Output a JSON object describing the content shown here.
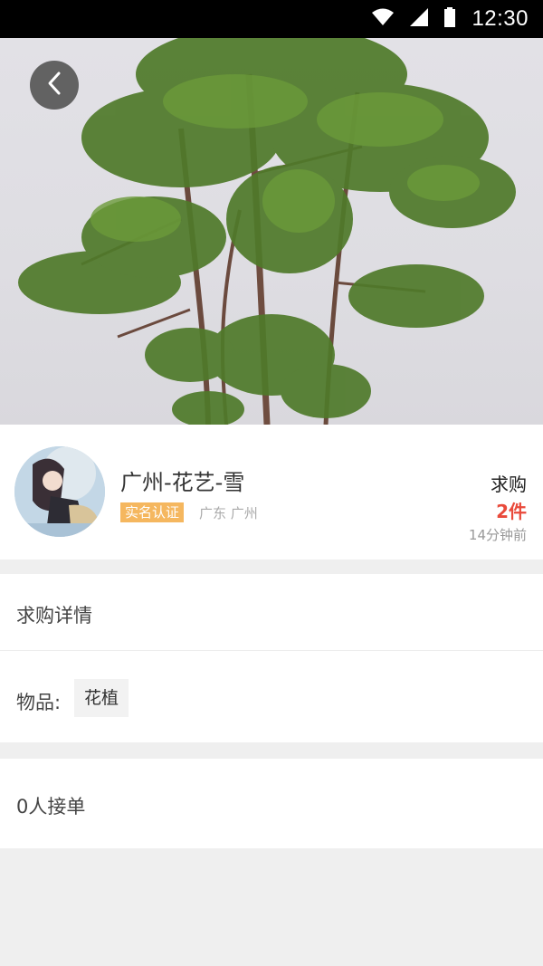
{
  "status_bar": {
    "time": "12:30",
    "icons": [
      "wifi-icon",
      "signal-icon",
      "battery-icon"
    ]
  },
  "hero": {
    "image": "potted-plant-photo",
    "back_icon": "chevron-left-icon"
  },
  "user": {
    "name": "广州-花艺-雪",
    "verified_badge": "实名认证",
    "location": "广东 广州",
    "avatar": "avatar-anime-girl"
  },
  "request": {
    "type_label": "求购",
    "quantity": "2件",
    "time_ago": "14分钟前"
  },
  "detail": {
    "section_title": "求购详情",
    "item_label": "物品:",
    "item_value": "花植"
  },
  "orders": {
    "text": "0人接单"
  },
  "colors": {
    "accent_red": "#e94a3b",
    "badge_orange": "#f5b75f",
    "background": "#efefef"
  }
}
